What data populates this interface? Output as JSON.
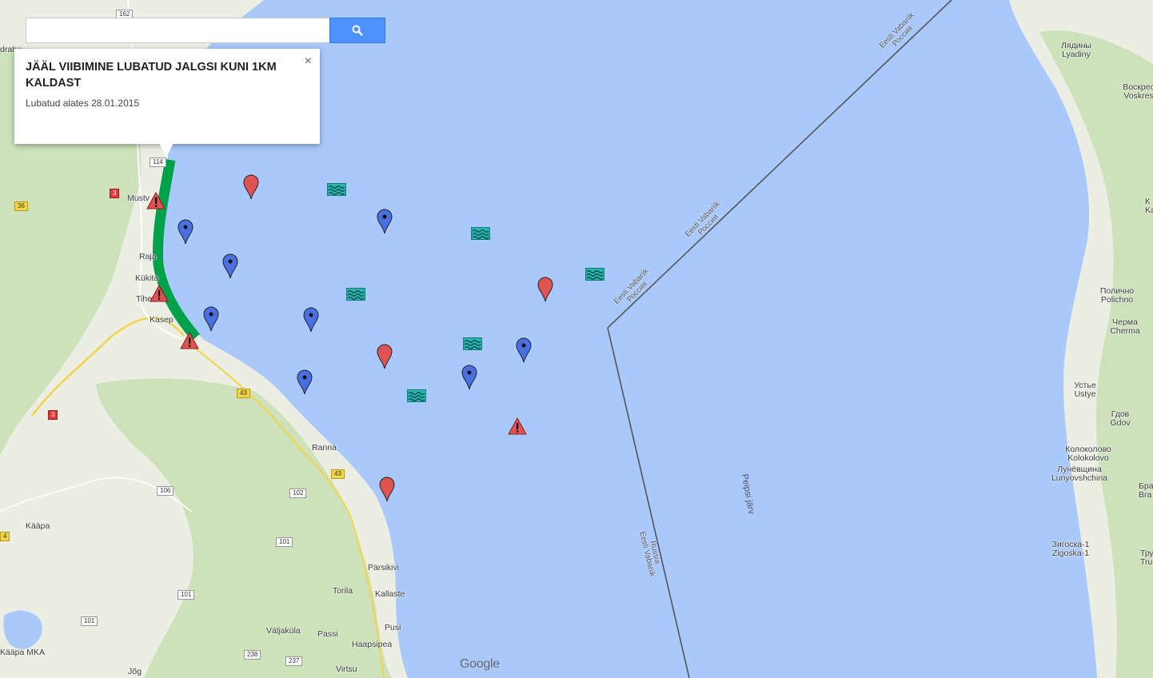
{
  "search": {
    "value": "",
    "placeholder": "",
    "button_icon": "search-icon"
  },
  "infowindow": {
    "title": "JÄÄL VIIBIMINE LUBATUD JALGSI KUNI 1KM KALDAST",
    "subtitle": "Lubatud alates 28.01.2015",
    "close_label": "×"
  },
  "places": {
    "mustvee": "Mustv",
    "raja": "Raja",
    "kukita": "Kükita",
    "tiheda": "Tihe",
    "kasepaa": "Kasep",
    "ranna": "Ranna",
    "kaapa": "Kääpa",
    "parsikivi": "Pärsikivi",
    "torila": "Torila",
    "kallaste": "Kallaste",
    "pusi": "Pusi",
    "valjakula": "Väljaküla",
    "passi": "Passi",
    "haapsipea": "Haapsipea",
    "virtsu": "Virtsu",
    "kaapa_mka": "Kääpa MKA",
    "joge": "Jõg",
    "dreta": "drahu",
    "lyadiny": "Лядины\nLyadiny",
    "voskresenskoe": "Воскрес\nVoskres",
    "polichno": "Поличнo\nPolichno",
    "cherma": "Черма\nCherma",
    "ustye": "Устье\nUstye",
    "gdov": "Гдов\nGdov",
    "kolokolovo": "Колоколово\nKolokolovo",
    "lunyovshchina": "Лунёвщина\nLunyovshchina",
    "zigoska": "Зигоска-1\nZigoska-1",
    "k_right": "К\nKa",
    "bra": "Бра\nBra",
    "tru": "Тру\nTru"
  },
  "lake_name": "Peipsi järv",
  "border_label_top": "Eesti Vabariik\nРоссия",
  "border_label_mid": "Eesti Vabariik\nРоссия",
  "border_label_low": "Eesti Vabariik\nРоссия",
  "border_label_south": "Russia\nEesti Vabariik",
  "roads": {
    "r162": "162",
    "r114": "114",
    "r3a": "3",
    "r36": "36",
    "r43a": "43",
    "r3b": "3",
    "r106": "106",
    "r102": "102",
    "r43b": "43",
    "r101a": "101",
    "r101b": "101",
    "r101c": "101",
    "r238": "238",
    "r237": "237",
    "r4": "4"
  },
  "logo": "Google",
  "colors": {
    "water": "#a9c9fb",
    "land": "#eceee4",
    "forest": "#c8dfb4",
    "permitted_zone": "#00a14b",
    "marker_red": "#e05353",
    "marker_blue": "#4a6fe0",
    "water_icon": "#2ab5b0",
    "search_button": "#4d90fe"
  },
  "markers": [
    {
      "type": "warning",
      "icon": "warning-triangle-icon"
    },
    {
      "type": "warning",
      "icon": "warning-triangle-icon"
    },
    {
      "type": "warning",
      "icon": "warning-triangle-icon"
    },
    {
      "type": "warning",
      "icon": "warning-triangle-icon"
    },
    {
      "type": "pin-red",
      "icon": "red-pin-icon"
    },
    {
      "type": "pin-red",
      "icon": "red-pin-icon"
    },
    {
      "type": "pin-red",
      "icon": "red-pin-icon"
    },
    {
      "type": "pin-red",
      "icon": "red-pin-icon"
    },
    {
      "type": "pin-blue",
      "icon": "blue-pin-icon"
    },
    {
      "type": "pin-blue",
      "icon": "blue-pin-icon"
    },
    {
      "type": "pin-blue",
      "icon": "blue-pin-icon"
    },
    {
      "type": "pin-blue",
      "icon": "blue-pin-icon"
    },
    {
      "type": "pin-blue",
      "icon": "blue-pin-icon"
    },
    {
      "type": "pin-blue",
      "icon": "blue-pin-icon"
    },
    {
      "type": "pin-blue",
      "icon": "blue-pin-icon"
    },
    {
      "type": "pin-blue",
      "icon": "blue-pin-icon"
    },
    {
      "type": "water",
      "icon": "open-water-icon"
    },
    {
      "type": "water",
      "icon": "open-water-icon"
    },
    {
      "type": "water",
      "icon": "open-water-icon"
    },
    {
      "type": "water",
      "icon": "open-water-icon"
    },
    {
      "type": "water",
      "icon": "open-water-icon"
    },
    {
      "type": "water",
      "icon": "open-water-icon"
    }
  ]
}
